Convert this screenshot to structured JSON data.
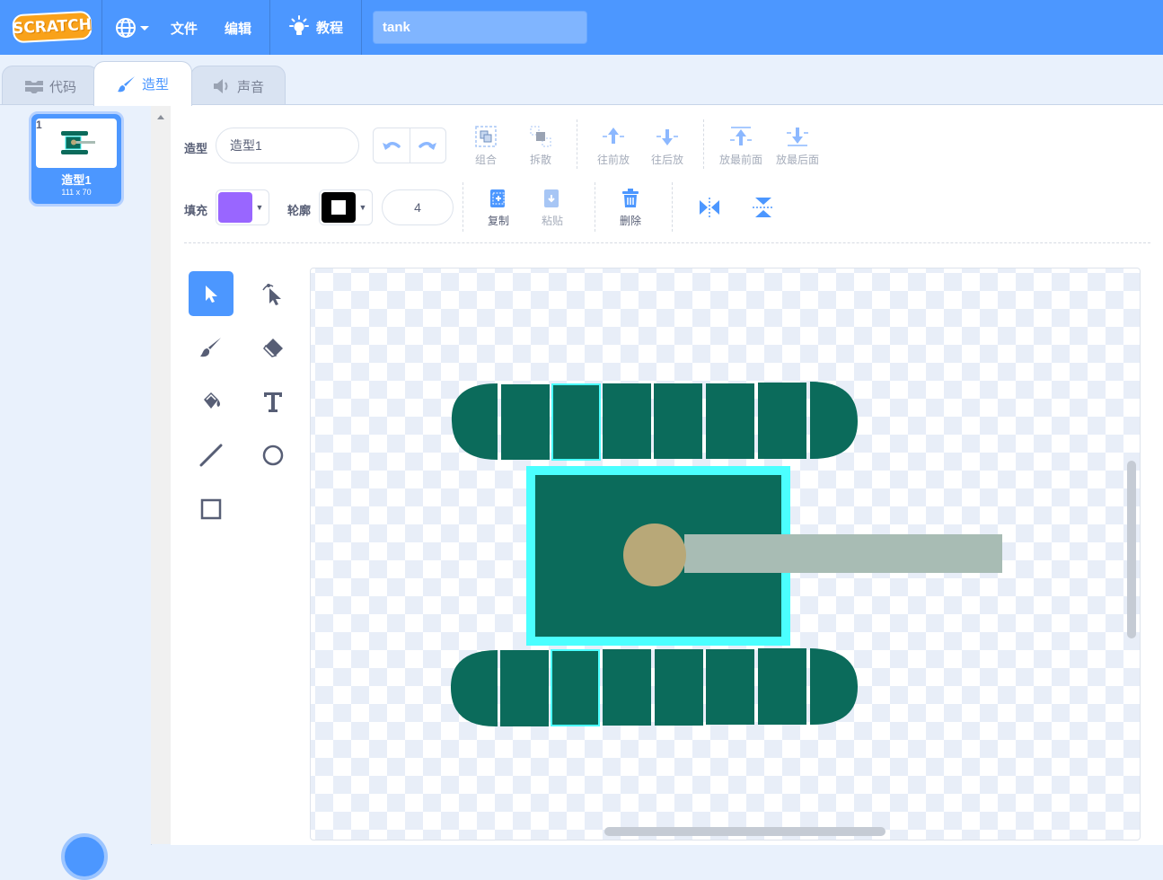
{
  "menubar": {
    "logo": "SCRATCH",
    "file": "文件",
    "edit": "编辑",
    "tutorials": "教程",
    "project_title": "tank"
  },
  "tabs": [
    {
      "label": "代码",
      "icon": "code-blocks-icon"
    },
    {
      "label": "造型",
      "icon": "paintbrush-icon",
      "active": true
    },
    {
      "label": "声音",
      "icon": "speaker-icon"
    }
  ],
  "costumes": [
    {
      "index": "1",
      "name": "造型1",
      "size": "111 x 70"
    }
  ],
  "toolbar": {
    "costume_label": "造型",
    "costume_name": "造型1",
    "group": "组合",
    "ungroup": "拆散",
    "forward": "往前放",
    "backward": "往后放",
    "front": "放最前面",
    "back": "放最后面",
    "fill_label": "填充",
    "outline_label": "轮廓",
    "stroke_width": "4",
    "copy": "复制",
    "paste": "粘贴",
    "delete": "删除"
  },
  "colors": {
    "accent": "#4c97ff",
    "fill": "#9966ff",
    "outline": "#000000",
    "tank_body": "#0b6b5b",
    "selection": "#4bffff",
    "turret": "#b8a878",
    "barrel": "#a8bcb4"
  },
  "tools": [
    "select-icon",
    "reshape-icon",
    "brush-icon",
    "eraser-icon",
    "fill-icon",
    "text-icon",
    "line-icon",
    "circle-icon",
    "rectangle-icon"
  ]
}
